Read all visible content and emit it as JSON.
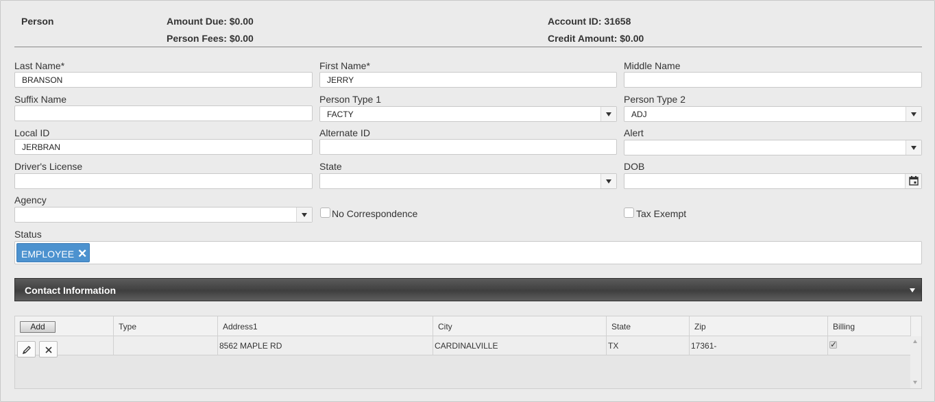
{
  "header": {
    "title": "Person",
    "amount_due": "Amount Due: $0.00",
    "person_fees": "Person Fees: $0.00",
    "account_id": "Account ID: 31658",
    "credit_amount": "Credit Amount: $0.00"
  },
  "form": {
    "last_name": {
      "label": "Last Name*",
      "value": "BRANSON"
    },
    "first_name": {
      "label": "First Name*",
      "value": "JERRY"
    },
    "middle_name": {
      "label": "Middle Name",
      "value": ""
    },
    "suffix_name": {
      "label": "Suffix Name",
      "value": ""
    },
    "person_type_1": {
      "label": "Person Type 1",
      "value": "FACTY"
    },
    "person_type_2": {
      "label": "Person Type 2",
      "value": "ADJ"
    },
    "local_id": {
      "label": "Local ID",
      "value": "JERBRAN"
    },
    "alternate_id": {
      "label": "Alternate ID",
      "value": ""
    },
    "alert": {
      "label": "Alert",
      "value": ""
    },
    "drivers_license": {
      "label": "Driver's License",
      "value": ""
    },
    "state": {
      "label": "State",
      "value": ""
    },
    "dob": {
      "label": "DOB",
      "value": ""
    },
    "agency": {
      "label": "Agency",
      "value": ""
    },
    "no_correspondence": {
      "label": "No Correspondence",
      "checked": false
    },
    "tax_exempt": {
      "label": "Tax Exempt",
      "checked": false
    },
    "status": {
      "label": "Status",
      "tags": [
        "EMPLOYEE"
      ],
      "remove_glyph": "✕"
    }
  },
  "contact_section": {
    "title": "Contact Information",
    "add_label": "Add",
    "columns": [
      "Type",
      "Address1",
      "City",
      "State",
      "Zip",
      "Billing"
    ],
    "rows": [
      {
        "type": "",
        "address1": "8562 MAPLE RD",
        "city": "CARDINALVILLE",
        "state": "TX",
        "zip": "17361-",
        "billing": true
      }
    ]
  },
  "icons": {
    "dropdown": "triangle-down-icon",
    "calendar": "calendar-icon",
    "edit": "pencil-icon",
    "delete": "close-icon",
    "tag_remove": "close-icon",
    "section_toggle": "chevron-down-icon"
  },
  "colors": {
    "tag_bg": "#4c92cf",
    "section_bar": "#4a4a4a",
    "page_bg": "#ebebeb"
  }
}
